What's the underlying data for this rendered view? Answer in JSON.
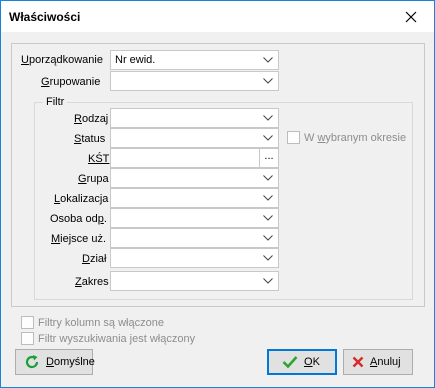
{
  "window": {
    "title": "Właściwości"
  },
  "fields": {
    "uporzadkowanie": {
      "label_pre": "",
      "label_u": "U",
      "label_post": "porządkowanie",
      "value": "Nr ewid."
    },
    "grupowanie": {
      "label_pre": "",
      "label_u": "G",
      "label_post": "rupowanie",
      "value": ""
    }
  },
  "filter": {
    "legend": "Filtr",
    "rodzaj": {
      "label_pre": "",
      "label_u": "R",
      "label_post": "odzaj",
      "value": ""
    },
    "status": {
      "label_pre": "",
      "label_u": "S",
      "label_post": "tatus",
      "value": ""
    },
    "kst": {
      "label_pre": "",
      "label_u": "KŚT",
      "label_post": "",
      "value": "",
      "button": "..."
    },
    "grupa": {
      "label_pre": "",
      "label_u": "G",
      "label_post": "rupa",
      "value": ""
    },
    "lokalizacja": {
      "label_pre": "",
      "label_u": "L",
      "label_post": "okalizacja",
      "value": ""
    },
    "osoba": {
      "label_pre": "Osoba od",
      "label_u": "p",
      "label_post": ".",
      "value": ""
    },
    "miejsce": {
      "label_pre": "",
      "label_u": "M",
      "label_post": "iejsce uż.",
      "value": ""
    },
    "dzial": {
      "label_pre": "",
      "label_u": "D",
      "label_post": "ział",
      "value": ""
    },
    "zakres": {
      "label_pre": "",
      "label_u": "Z",
      "label_post": "akres",
      "value": ""
    },
    "w_wybranym": {
      "label_pre": "W ",
      "label_u": "w",
      "label_post": "ybranym okresie",
      "checked": false
    }
  },
  "checkboxes": {
    "filtry_kolumn": {
      "label": "Filtry kolumn są włączone",
      "checked": false
    },
    "filtr_wyszukiwania": {
      "label": "Filtr wyszukiwania jest włączony",
      "checked": false
    }
  },
  "buttons": {
    "domyslne": {
      "label_pre": "",
      "label_u": "D",
      "label_post": "omyślne"
    },
    "ok": {
      "label_pre": "",
      "label_u": "O",
      "label_post": "K"
    },
    "anuluj": {
      "label_pre": "",
      "label_u": "A",
      "label_post": "nuluj"
    }
  },
  "colors": {
    "accent": "#1883d7",
    "ok_green": "#2ea52e",
    "cancel_red": "#d62b2b",
    "refresh_green": "#1a9e3a"
  }
}
